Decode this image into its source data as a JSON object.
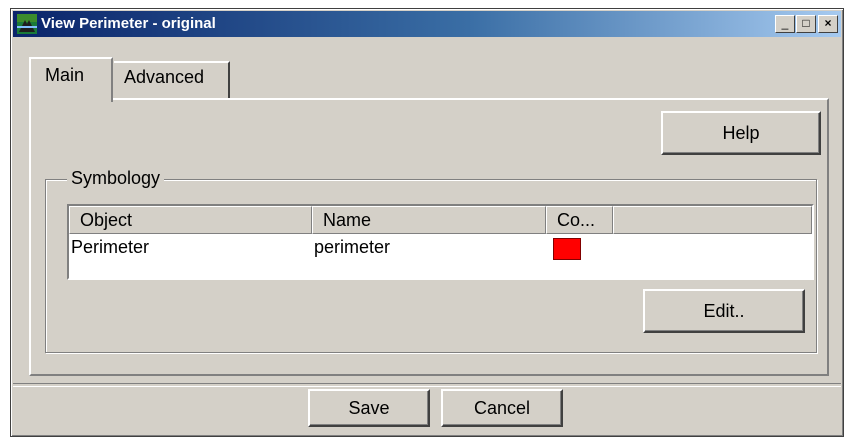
{
  "window": {
    "title": "View Perimeter - original",
    "controls": {
      "minimize": "_",
      "maximize": "□",
      "close": "×"
    }
  },
  "tabs": [
    {
      "label": "Main",
      "active": true
    },
    {
      "label": "Advanced",
      "active": false
    }
  ],
  "main": {
    "help_label": "Help",
    "symbology": {
      "label": "Symbology",
      "columns": [
        "Object",
        "Name",
        "Co...",
        ""
      ],
      "rows": [
        {
          "object": "Perimeter",
          "name": "perimeter",
          "color": "#ff0000"
        }
      ],
      "edit_label": "Edit.."
    }
  },
  "footer": {
    "save_label": "Save",
    "cancel_label": "Cancel"
  },
  "colors": {
    "titlebar": "#0a246a",
    "face": "#d4d0c8",
    "perimeter_swatch": "#ff0000"
  },
  "icons": {
    "app": "map-icon"
  }
}
